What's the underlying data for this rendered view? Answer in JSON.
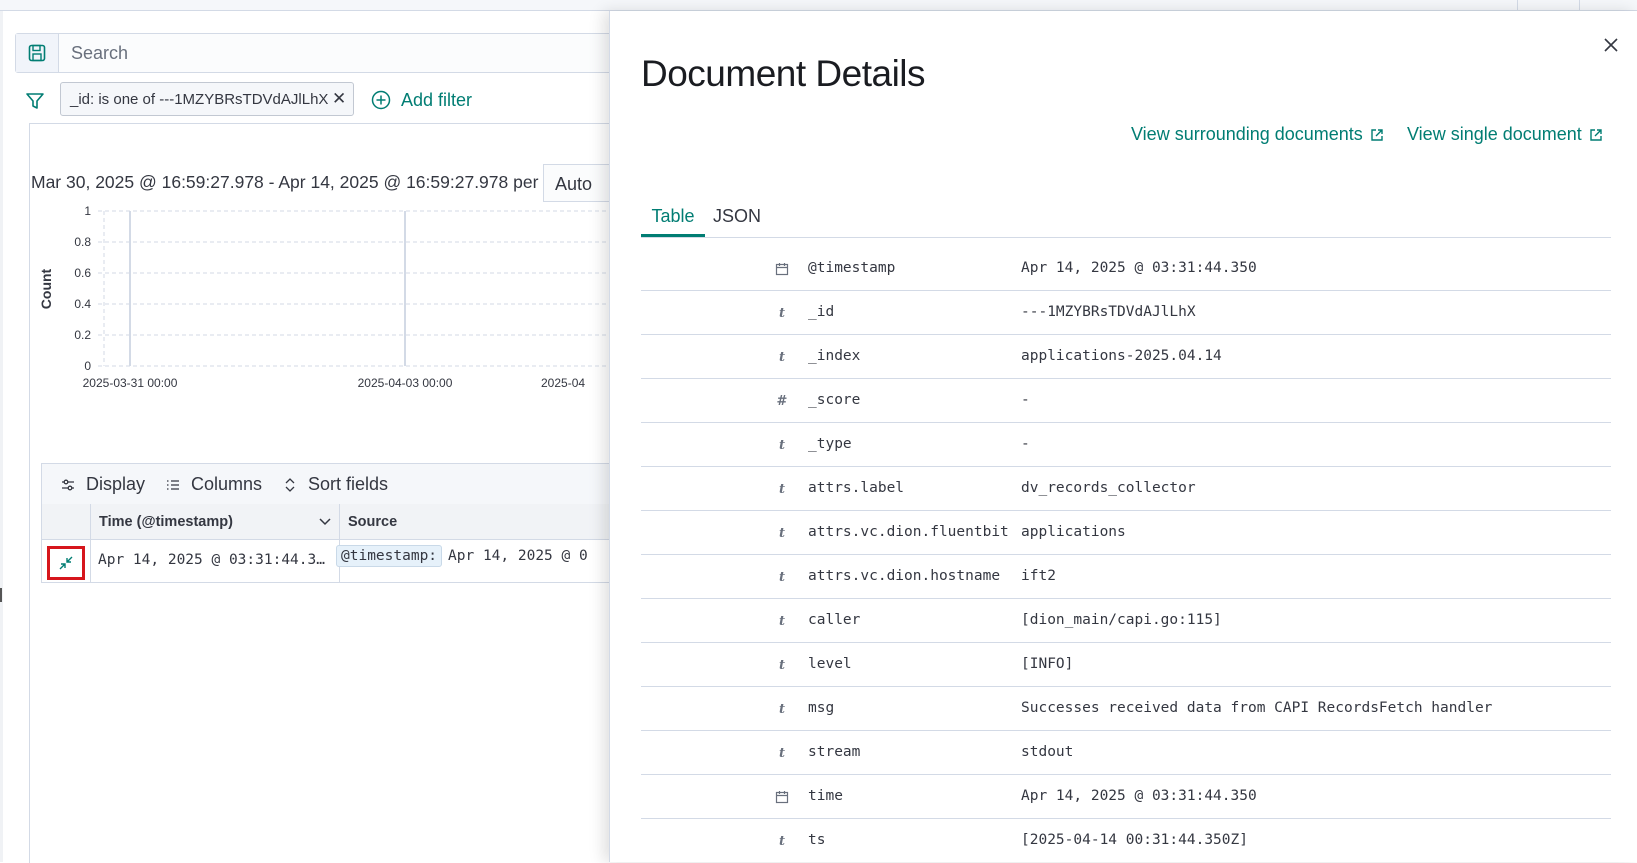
{
  "left": {
    "search": {
      "placeholder": "Search"
    },
    "filter_pill": {
      "label": "_id: is one of ---1MZYBRsTDVdAJlLhX"
    },
    "add_filter_label": "Add filter",
    "time_range": "Mar 30, 2025 @ 16:59:27.978 - Apr 14, 2025 @ 16:59:27.978 per",
    "interval_select": "Auto",
    "chart": {
      "ylabel": "Count",
      "y_ticks": [
        "1",
        "0.8",
        "0.6",
        "0.4",
        "0.2",
        "0"
      ],
      "x_ticks": [
        "2025-03-31 00:00",
        "2025-04-03 00:00",
        "2025-04"
      ]
    },
    "toolbar": {
      "display": "Display",
      "columns": "Columns",
      "sort_fields": "Sort fields"
    },
    "grid": {
      "col_time": "Time (@timestamp)",
      "col_source": "Source",
      "row": {
        "time": "Apr 14, 2025 @ 03:31:44.3…",
        "source_key": "@timestamp:",
        "source_value": "Apr 14, 2025 @ 0"
      }
    }
  },
  "flyout": {
    "title": "Document Details",
    "link_surrounding": "View surrounding documents",
    "link_single": "View single document",
    "tabs": [
      {
        "label": "Table",
        "active": true
      },
      {
        "label": "JSON",
        "active": false
      }
    ],
    "fields": [
      {
        "type": "date",
        "name": "@timestamp",
        "value": "Apr 14, 2025 @ 03:31:44.350"
      },
      {
        "type": "string",
        "name": "_id",
        "value": "---1MZYBRsTDVdAJlLhX"
      },
      {
        "type": "string",
        "name": "_index",
        "value": "applications-2025.04.14"
      },
      {
        "type": "number",
        "name": "_score",
        "value": " -"
      },
      {
        "type": "string",
        "name": "_type",
        "value": " -"
      },
      {
        "type": "string",
        "name": "attrs.label",
        "value": "dv_records_collector"
      },
      {
        "type": "string",
        "name": "attrs.vc.dion.fluentbit",
        "value": "applications"
      },
      {
        "type": "string",
        "name": "attrs.vc.dion.hostname",
        "value": "ift2"
      },
      {
        "type": "string",
        "name": "caller",
        "value": "[dion_main/capi.go:115]"
      },
      {
        "type": "string",
        "name": "level",
        "value": "[INFO]"
      },
      {
        "type": "string",
        "name": "msg",
        "value": "Successes received data from CAPI RecordsFetch handler"
      },
      {
        "type": "string",
        "name": "stream",
        "value": "stdout"
      },
      {
        "type": "date",
        "name": "time",
        "value": "Apr 14, 2025 @ 03:31:44.350"
      },
      {
        "type": "string",
        "name": "ts",
        "value": "[2025-04-14 00:31:44.350Z]"
      }
    ]
  },
  "colors": {
    "accent": "#017d73",
    "highlight_box": "#d6161c"
  }
}
